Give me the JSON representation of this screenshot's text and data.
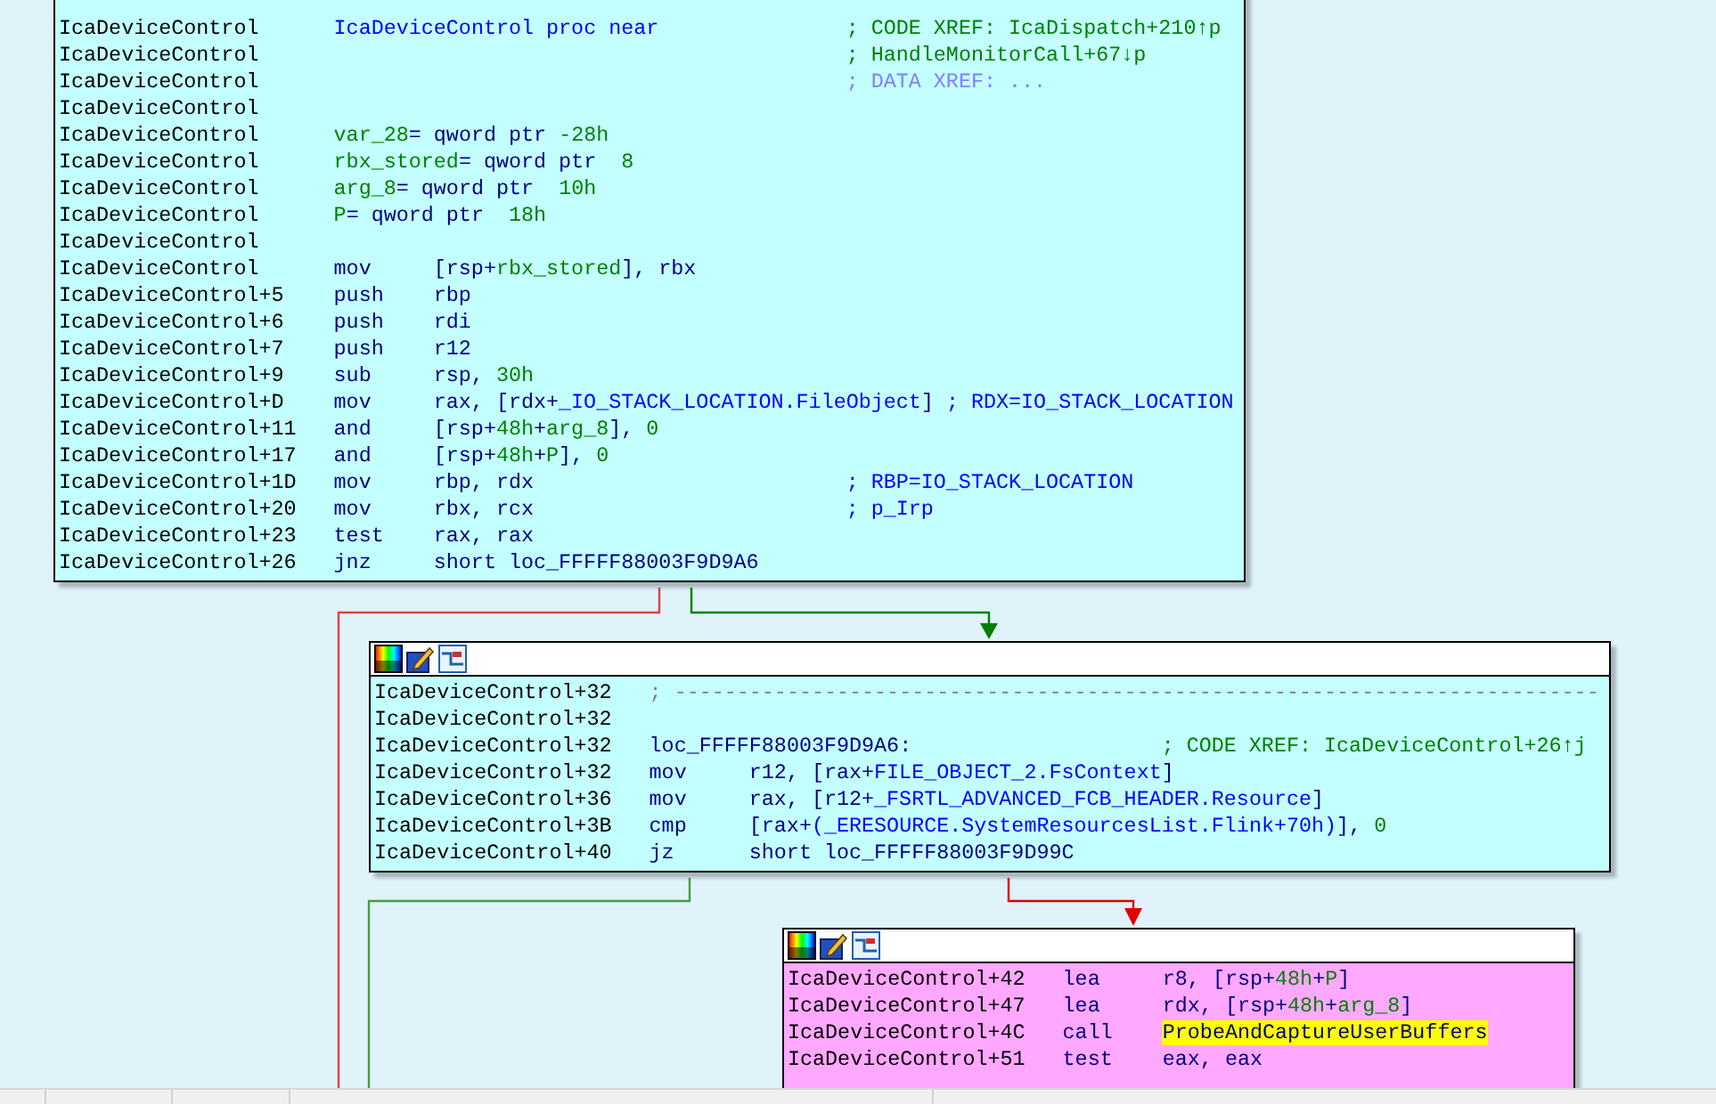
{
  "blocks": [
    {
      "color": "#c4ffff",
      "header": false,
      "lines": [
        {
          "addr": "IcaDeviceControl",
          "ops": [
            {
              "text": "IcaDeviceControl proc near",
              "kind": "ref"
            }
          ],
          "comment": {
            "text": "; CODE XREF: IcaDispatch+210↑p",
            "kind": "xref"
          }
        },
        {
          "addr": "IcaDeviceControl",
          "comment": {
            "text": "; HandleMonitorCall+67↓p",
            "kind": "xref"
          }
        },
        {
          "addr": "IcaDeviceControl",
          "comment": {
            "text": "; DATA XREF: ...",
            "kind": "data_xref"
          }
        },
        {
          "addr": "IcaDeviceControl"
        },
        {
          "addr": "IcaDeviceControl",
          "ops": [
            {
              "text": "var_28",
              "kind": "var"
            },
            {
              "text": "= qword ptr ",
              "kind": "code"
            },
            {
              "text": "-28h",
              "kind": "var"
            }
          ]
        },
        {
          "addr": "IcaDeviceControl",
          "ops": [
            {
              "text": "rbx_stored",
              "kind": "var"
            },
            {
              "text": "= qword ptr  ",
              "kind": "code"
            },
            {
              "text": "8",
              "kind": "var"
            }
          ]
        },
        {
          "addr": "IcaDeviceControl",
          "ops": [
            {
              "text": "arg_8",
              "kind": "var"
            },
            {
              "text": "= qword ptr  ",
              "kind": "code"
            },
            {
              "text": "10h",
              "kind": "var"
            }
          ]
        },
        {
          "addr": "IcaDeviceControl",
          "ops": [
            {
              "text": "P",
              "kind": "var"
            },
            {
              "text": "= qword ptr  ",
              "kind": "code"
            },
            {
              "text": "18h",
              "kind": "var"
            }
          ]
        },
        {
          "addr": "IcaDeviceControl"
        },
        {
          "addr": "IcaDeviceControl",
          "mnem": "mov",
          "ops": [
            {
              "text": "[rsp+",
              "kind": "code"
            },
            {
              "text": "rbx_stored",
              "kind": "var"
            },
            {
              "text": "], rbx",
              "kind": "code"
            }
          ]
        },
        {
          "addr": "IcaDeviceControl+5",
          "mnem": "push",
          "ops": [
            {
              "text": "rbp",
              "kind": "code"
            }
          ]
        },
        {
          "addr": "IcaDeviceControl+6",
          "mnem": "push",
          "ops": [
            {
              "text": "rdi",
              "kind": "code"
            }
          ]
        },
        {
          "addr": "IcaDeviceControl+7",
          "mnem": "push",
          "ops": [
            {
              "text": "r12",
              "kind": "code"
            }
          ]
        },
        {
          "addr": "IcaDeviceControl+9",
          "mnem": "sub",
          "ops": [
            {
              "text": "rsp, ",
              "kind": "code"
            },
            {
              "text": "30h",
              "kind": "var"
            }
          ]
        },
        {
          "addr": "IcaDeviceControl+D",
          "mnem": "mov",
          "ops": [
            {
              "text": "rax, [rdx+",
              "kind": "code"
            },
            {
              "text": "_IO_STACK_LOCATION.FileObject",
              "kind": "ref"
            },
            {
              "text": "]",
              "kind": "code"
            }
          ],
          "comment": {
            "text": "; RDX=IO_STACK_LOCATION",
            "kind": "note"
          }
        },
        {
          "addr": "IcaDeviceControl+11",
          "mnem": "and",
          "ops": [
            {
              "text": "[rsp+",
              "kind": "code"
            },
            {
              "text": "48h",
              "kind": "var"
            },
            {
              "text": "+",
              "kind": "code"
            },
            {
              "text": "arg_8",
              "kind": "var"
            },
            {
              "text": "], ",
              "kind": "code"
            },
            {
              "text": "0",
              "kind": "var"
            }
          ]
        },
        {
          "addr": "IcaDeviceControl+17",
          "mnem": "and",
          "ops": [
            {
              "text": "[rsp+",
              "kind": "code"
            },
            {
              "text": "48h",
              "kind": "var"
            },
            {
              "text": "+",
              "kind": "code"
            },
            {
              "text": "P",
              "kind": "var"
            },
            {
              "text": "], ",
              "kind": "code"
            },
            {
              "text": "0",
              "kind": "var"
            }
          ]
        },
        {
          "addr": "IcaDeviceControl+1D",
          "mnem": "mov",
          "ops": [
            {
              "text": "rbp, rdx",
              "kind": "code"
            }
          ],
          "comment": {
            "text": "; RBP=IO_STACK_LOCATION",
            "kind": "note"
          }
        },
        {
          "addr": "IcaDeviceControl+20",
          "mnem": "mov",
          "ops": [
            {
              "text": "rbx, rcx",
              "kind": "code"
            }
          ],
          "comment": {
            "text": "; p_Irp",
            "kind": "note"
          }
        },
        {
          "addr": "IcaDeviceControl+23",
          "mnem": "test",
          "ops": [
            {
              "text": "rax, rax",
              "kind": "code"
            }
          ]
        },
        {
          "addr": "IcaDeviceControl+26",
          "mnem": "jnz",
          "ops": [
            {
              "text": "short loc_FFFFF88003F9D9A6",
              "kind": "code"
            }
          ]
        }
      ]
    },
    {
      "color": "#c4ffff",
      "header": true,
      "lines": [
        {
          "addr": "IcaDeviceControl+32",
          "ops": [
            {
              "text": "; --------------------------------------------------------------------------",
              "kind": "separator"
            }
          ]
        },
        {
          "addr": "IcaDeviceControl+32"
        },
        {
          "addr": "IcaDeviceControl+32",
          "ops": [
            {
              "text": "loc_FFFFF88003F9D9A6:",
              "kind": "code"
            }
          ],
          "comment": {
            "text": "; CODE XREF: IcaDeviceControl+26↑j",
            "kind": "xref"
          }
        },
        {
          "addr": "IcaDeviceControl+32",
          "mnem": "mov",
          "ops": [
            {
              "text": "r12, [rax+",
              "kind": "code"
            },
            {
              "text": "FILE_OBJECT_2.FsContext",
              "kind": "ref"
            },
            {
              "text": "]",
              "kind": "code"
            }
          ]
        },
        {
          "addr": "IcaDeviceControl+36",
          "mnem": "mov",
          "ops": [
            {
              "text": "rax, [r12+",
              "kind": "code"
            },
            {
              "text": "_FSRTL_ADVANCED_FCB_HEADER.Resource",
              "kind": "ref"
            },
            {
              "text": "]",
              "kind": "code"
            }
          ]
        },
        {
          "addr": "IcaDeviceControl+3B",
          "mnem": "cmp",
          "ops": [
            {
              "text": "[rax+",
              "kind": "code"
            },
            {
              "text": "(_ERESOURCE.SystemResourcesList.Flink+70h)",
              "kind": "ref"
            },
            {
              "text": "], ",
              "kind": "code"
            },
            {
              "text": "0",
              "kind": "var"
            }
          ]
        },
        {
          "addr": "IcaDeviceControl+40",
          "mnem": "jz",
          "ops": [
            {
              "text": "short loc_FFFFF88003F9D99C",
              "kind": "code"
            }
          ]
        }
      ]
    },
    {
      "color": "#ffa8ff",
      "header": true,
      "lines": [
        {
          "addr": "IcaDeviceControl+42",
          "mnem": "lea",
          "ops": [
            {
              "text": "r8, [rsp+",
              "kind": "code"
            },
            {
              "text": "48h",
              "kind": "var"
            },
            {
              "text": "+",
              "kind": "code"
            },
            {
              "text": "P",
              "kind": "var"
            },
            {
              "text": "]",
              "kind": "code"
            }
          ]
        },
        {
          "addr": "IcaDeviceControl+47",
          "mnem": "lea",
          "ops": [
            {
              "text": "rdx, [rsp+",
              "kind": "code"
            },
            {
              "text": "48h",
              "kind": "var"
            },
            {
              "text": "+",
              "kind": "code"
            },
            {
              "text": "arg_8",
              "kind": "var"
            },
            {
              "text": "]",
              "kind": "code"
            }
          ]
        },
        {
          "addr": "IcaDeviceControl+4C",
          "mnem": "call",
          "ops": [
            {
              "text": "ProbeAndCaptureUserBuffers",
              "kind": "highlight"
            }
          ]
        },
        {
          "addr": "IcaDeviceControl+51",
          "mnem": "test",
          "ops": [
            {
              "text": "eax, eax",
              "kind": "code"
            }
          ]
        }
      ]
    }
  ]
}
